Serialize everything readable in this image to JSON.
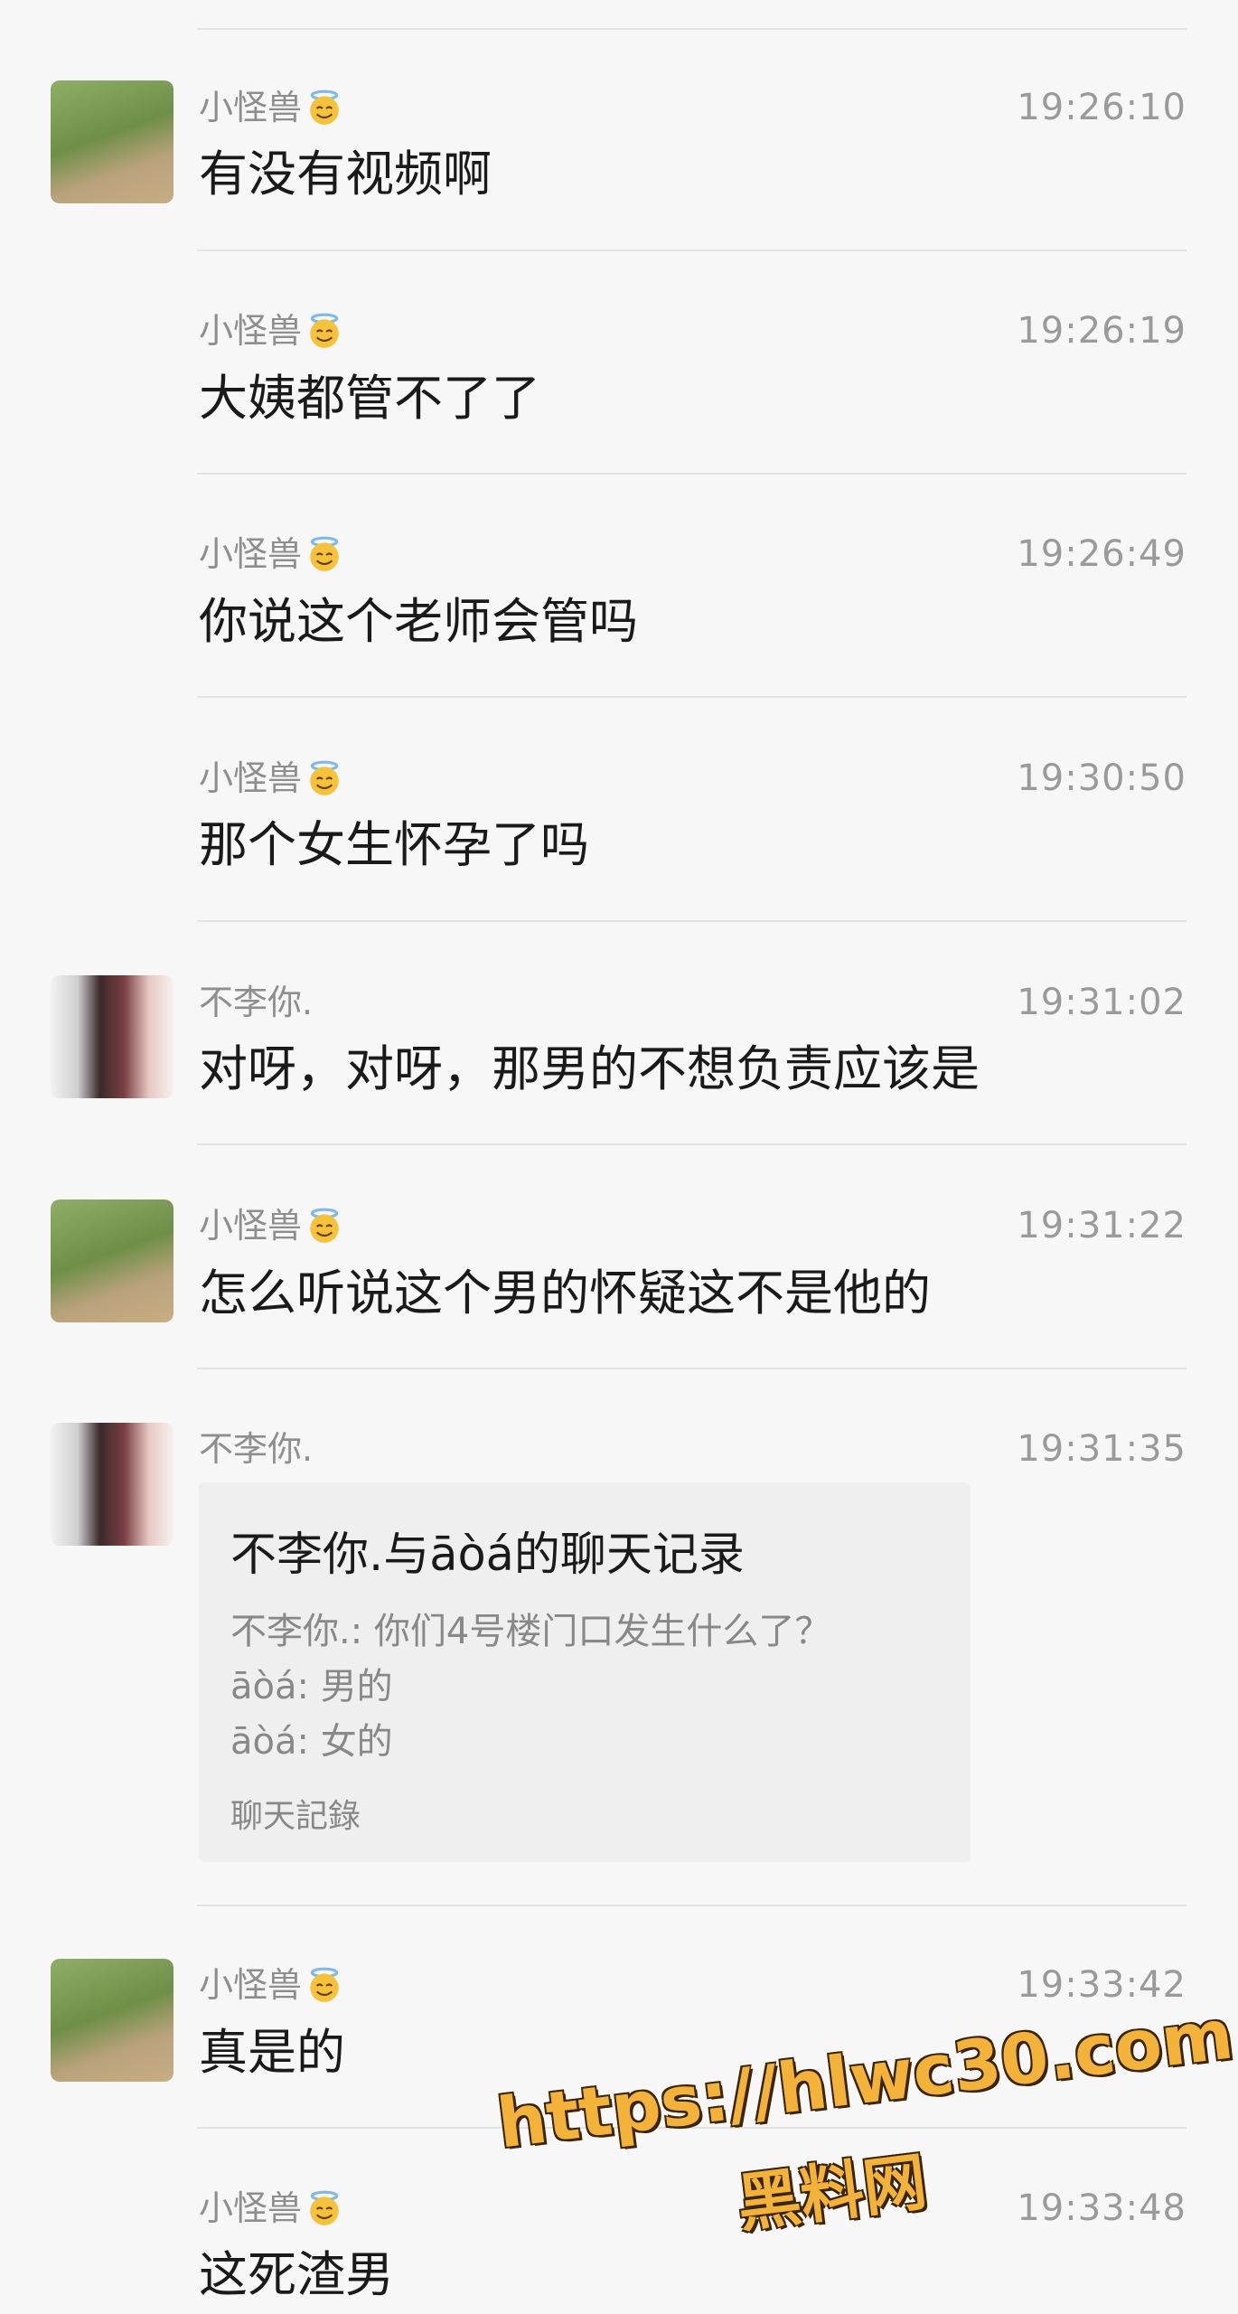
{
  "messages": [
    {
      "sender": "小怪兽",
      "time": "19:26:10",
      "text": "有没有视频啊"
    },
    {
      "sender": "小怪兽",
      "time": "19:26:19",
      "text": "大姨都管不了了"
    },
    {
      "sender": "小怪兽",
      "time": "19:26:49",
      "text": "你说这个老师会管吗"
    },
    {
      "sender": "小怪兽",
      "time": "19:30:50",
      "text": "那个女生怀孕了吗"
    },
    {
      "sender": "不李你.",
      "time": "19:31:02",
      "text": "对呀，对呀，那男的不想负责应该是"
    },
    {
      "sender": "小怪兽",
      "time": "19:31:22",
      "text": "怎么听说这个男的怀疑这不是他的"
    },
    {
      "sender": "不李你.",
      "time": "19:31:35"
    },
    {
      "sender": "小怪兽",
      "time": "19:33:42",
      "text": "真是的"
    },
    {
      "sender": "小怪兽",
      "time": "19:33:48",
      "text": "这死渣男"
    }
  ],
  "chat_record": {
    "title": "不李你.与āòá的聊天记录",
    "lines": [
      "不李你.: 你们4号楼门口发生什么了？",
      "āòá: 男的",
      "āòá: 女的"
    ],
    "footer": "聊天記錄"
  },
  "watermark": {
    "url": "https://hlwc30.com",
    "site": "黑料网"
  },
  "colors": {
    "accent_watermark": "#f3b23a",
    "name": "#8e8e8e",
    "text": "#1a1a1a"
  }
}
